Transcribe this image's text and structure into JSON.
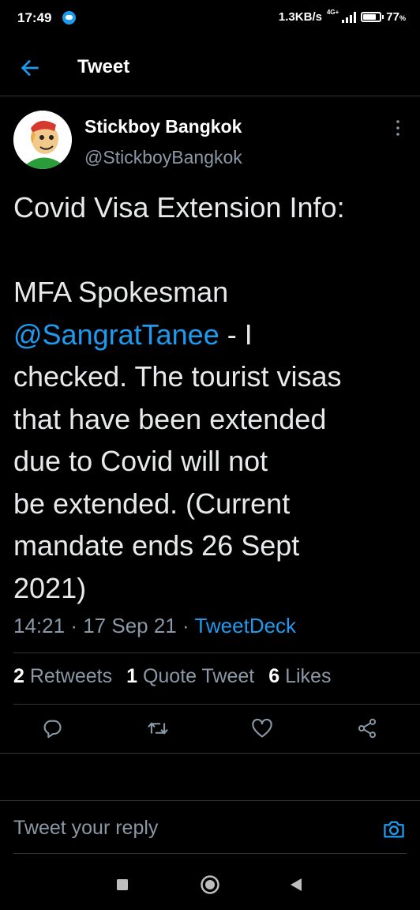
{
  "status_bar": {
    "time": "17:49",
    "speed": "1.3KB/s",
    "network": "4G+",
    "battery": "77",
    "battery_unit": "%"
  },
  "header": {
    "title": "Tweet",
    "back_icon": "arrow-left-icon"
  },
  "author": {
    "name": "Stickboy Bangkok",
    "handle": "@StickboyBangkok"
  },
  "tweet": {
    "line1": "Covid Visa Extension Info:",
    "line2": "MFA Spokesman",
    "mention": "@SangratTanee",
    "line3_tail": " - I",
    "line4": "checked.  The tourist visas",
    "line5": "that have been extended",
    "line6": "due to Covid will not",
    "line7": "be extended. (Current",
    "line8": "mandate ends 26 Sept",
    "line9": "2021)",
    "time": "14:21",
    "date": "17 Sep 21",
    "separator": "·",
    "source": "TweetDeck"
  },
  "stats": {
    "retweets_count": "2",
    "retweets_label": "Retweets",
    "quotes_count": "1",
    "quotes_label": "Quote Tweet",
    "likes_count": "6",
    "likes_label": "Likes"
  },
  "actions": [
    "reply-icon",
    "retweet-icon",
    "like-icon",
    "share-icon"
  ],
  "reply": {
    "placeholder": "Tweet your reply"
  },
  "colors": {
    "background": "#000000",
    "accent": "#1d9bf0",
    "muted": "#8b98a5",
    "text": "#e7e9ea"
  }
}
